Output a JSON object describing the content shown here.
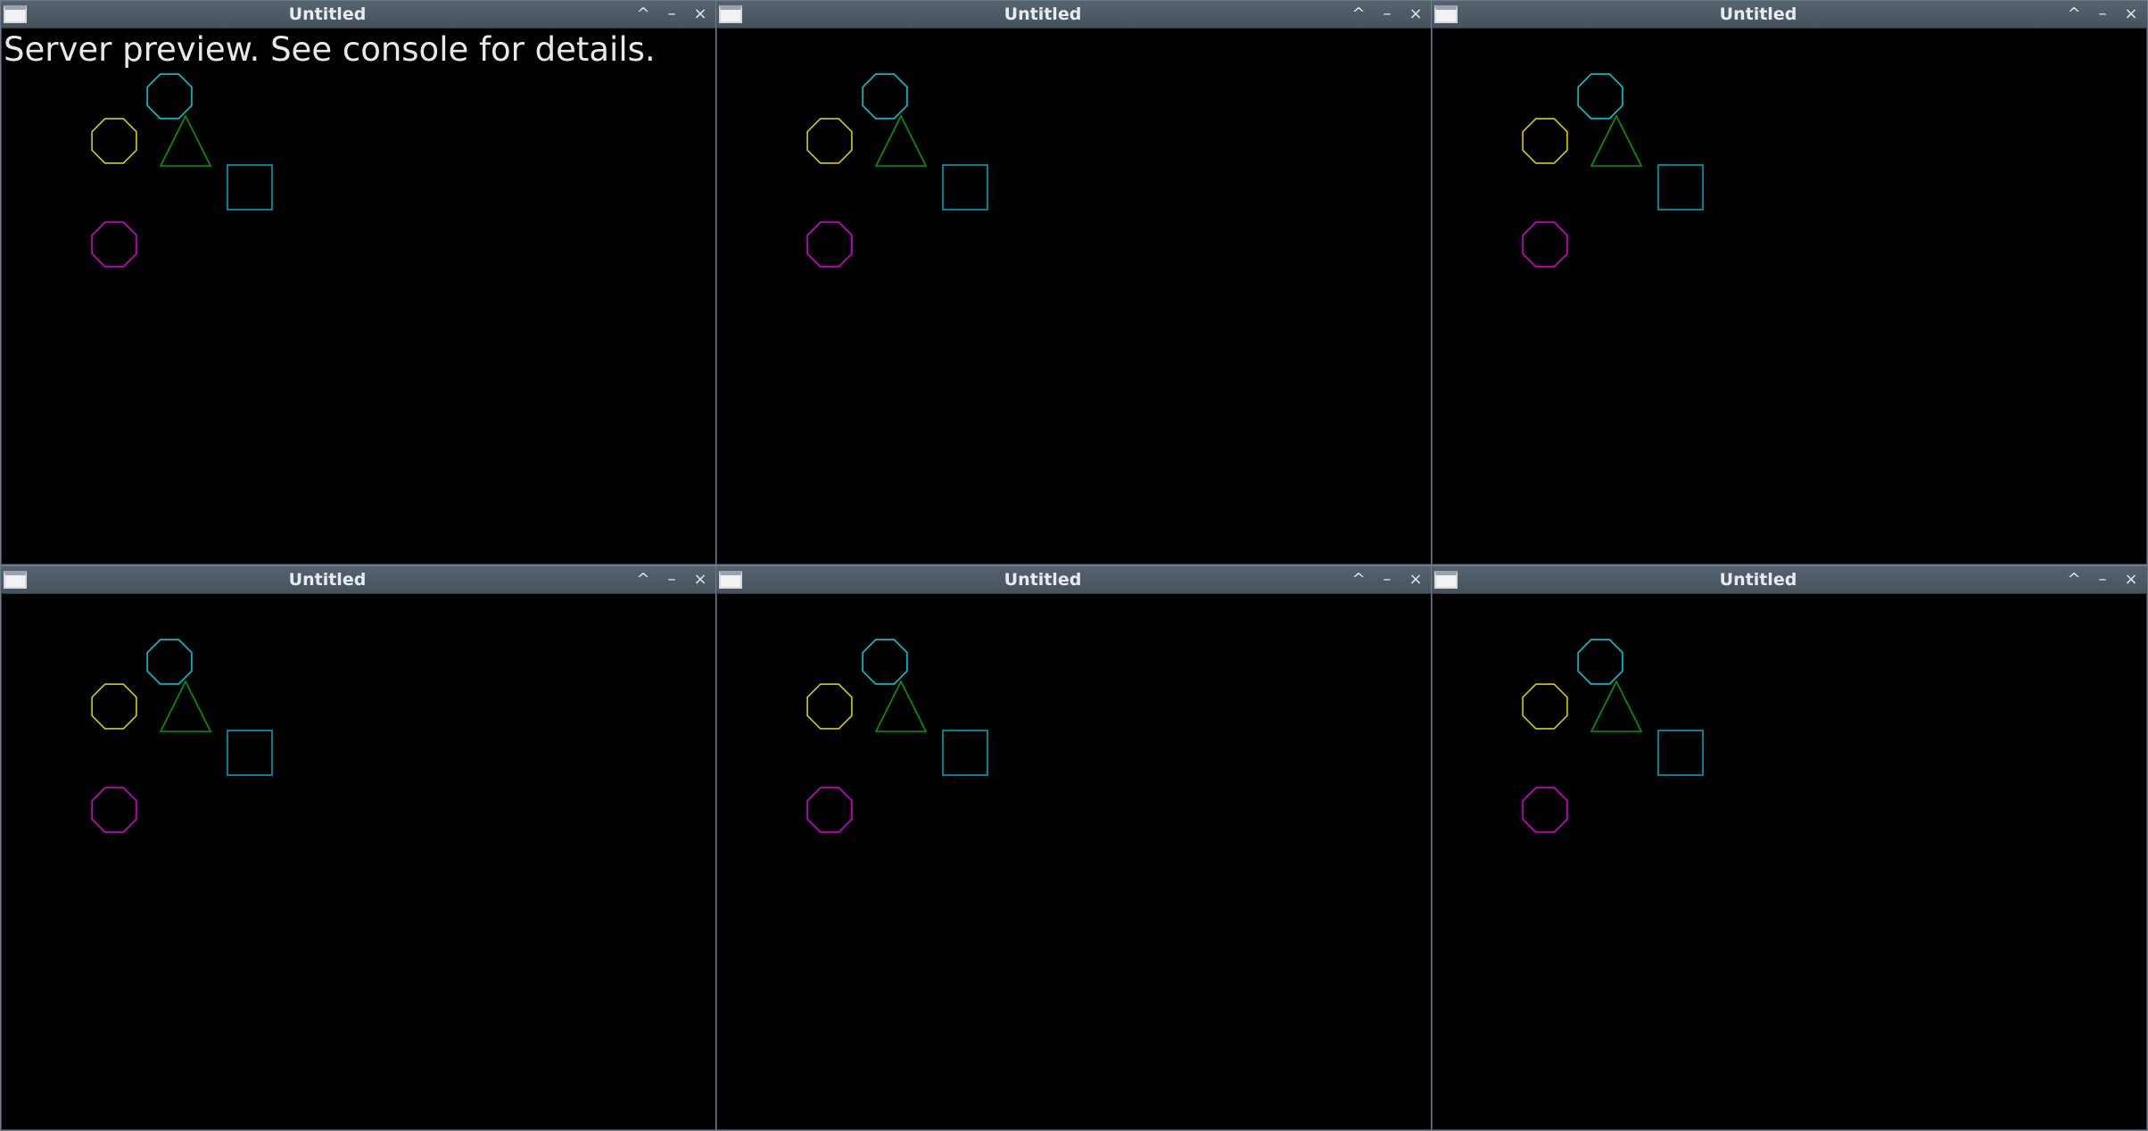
{
  "windows": [
    {
      "title": "Untitled",
      "overlay": "Server preview. See console for details."
    },
    {
      "title": "Untitled",
      "overlay": ""
    },
    {
      "title": "Untitled",
      "overlay": ""
    },
    {
      "title": "Untitled",
      "overlay": ""
    },
    {
      "title": "Untitled",
      "overlay": ""
    },
    {
      "title": "Untitled",
      "overlay": ""
    }
  ],
  "controls": {
    "maximize": "^",
    "minimize": "–",
    "close": "×"
  },
  "shapes": [
    {
      "name": "cyan-octagon",
      "kind": "octagon",
      "color": "#00c8d2"
    },
    {
      "name": "yellow-octagon",
      "kind": "octagon",
      "color": "#d2d200"
    },
    {
      "name": "green-triangle",
      "kind": "triangle",
      "color": "#009a00"
    },
    {
      "name": "teal-square",
      "kind": "square",
      "color": "#00a0b4"
    },
    {
      "name": "magenta-octagon",
      "kind": "octagon",
      "color": "#d200d2"
    }
  ]
}
